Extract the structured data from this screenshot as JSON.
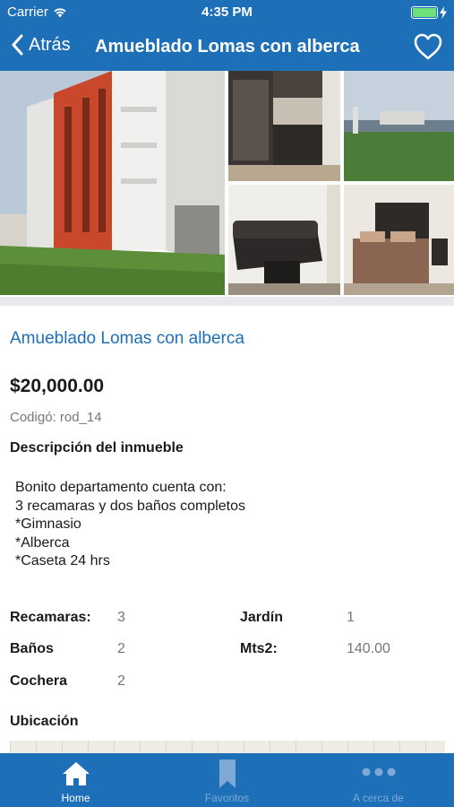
{
  "status_bar": {
    "carrier": "Carrier",
    "time": "4:35 PM",
    "battery_level": 1.0
  },
  "nav": {
    "back_label": "Atrás",
    "title": "Amueblado Lomas con alberca",
    "favorite_icon": "heart-outline-icon"
  },
  "colors": {
    "brand": "#1d6fb8",
    "title_link": "#1d6fb8",
    "muted": "#777777",
    "separator": "#e9e9ec"
  },
  "property": {
    "title": "Amueblado Lomas con alberca",
    "price": "$20,000.00",
    "code": "Codigó: rod_14",
    "description_label": "Descripción del inmueble",
    "description_lines": [
      "Bonito departamento cuenta con:",
      "3 recamaras y dos baños completos",
      "*Gimnasio",
      "*Alberca",
      "*Caseta 24 hrs"
    ],
    "features": [
      {
        "label": "Recamaras:",
        "value": "3"
      },
      {
        "label": "Jardín",
        "value": "1"
      },
      {
        "label": "Baños",
        "value": "2"
      },
      {
        "label": "Mts2:",
        "value": "140.00"
      },
      {
        "label": "Cochera",
        "value": "2"
      }
    ],
    "location_label": "Ubicación"
  },
  "tabs": [
    {
      "label": "Home",
      "icon": "home-icon",
      "active": true
    },
    {
      "label": "Favoritos",
      "icon": "bookmark-icon",
      "active": false
    },
    {
      "label": "A cerca de",
      "icon": "more-dots-icon",
      "active": false
    }
  ]
}
